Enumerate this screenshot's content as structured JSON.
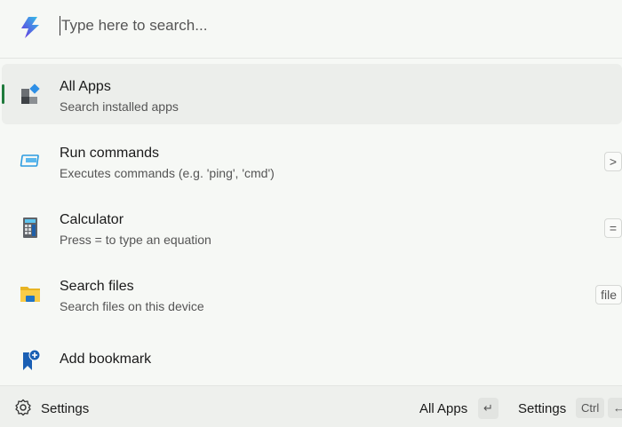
{
  "search": {
    "placeholder": "Type here to search..."
  },
  "items": [
    {
      "title": "All Apps",
      "subtitle": "Search installed apps"
    },
    {
      "title": "Run commands",
      "subtitle": "Executes commands (e.g. 'ping', 'cmd')",
      "key": ">"
    },
    {
      "title": "Calculator",
      "subtitle": "Press = to type an equation",
      "key": "="
    },
    {
      "title": "Search files",
      "subtitle": "Search files on this device",
      "key": "file"
    },
    {
      "title": "Add bookmark"
    }
  ],
  "footer": {
    "settings": "Settings",
    "primary_action": "All Apps",
    "primary_key": "↵",
    "secondary_action": "Settings",
    "secondary_key": "Ctrl",
    "secondary_key2": "←"
  },
  "colors": {
    "accent": "#1f7a3c"
  }
}
